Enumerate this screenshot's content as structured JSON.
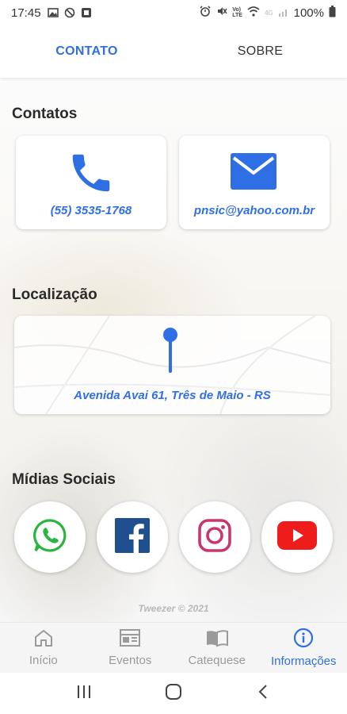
{
  "statusbar": {
    "time": "17:45",
    "battery": "100%",
    "network": "4G",
    "volte": "Vo))\nLTE"
  },
  "tabs": [
    {
      "label": "CONTATO",
      "active": true
    },
    {
      "label": "SOBRE",
      "active": false
    }
  ],
  "contacts": {
    "title": "Contatos",
    "phone": {
      "icon": "phone-icon",
      "label": "(55) 3535-1768"
    },
    "email": {
      "icon": "mail-icon",
      "label": "pnsic@yahoo.com.br"
    }
  },
  "location": {
    "title": "Localização",
    "address": "Avenida Avai 61, Três de Maio - RS",
    "icon": "map-pin-icon"
  },
  "social": {
    "title": "Mídias Sociais",
    "items": [
      {
        "name": "whatsapp",
        "icon": "whatsapp-icon",
        "color": "#2ab540"
      },
      {
        "name": "facebook",
        "icon": "facebook-icon",
        "color": "#1f4f8e"
      },
      {
        "name": "instagram",
        "icon": "instagram-icon",
        "color": "#c7366f"
      },
      {
        "name": "youtube",
        "icon": "youtube-icon",
        "color": "#ee1c1b"
      }
    ]
  },
  "footer": {
    "copyright": "Tweezer © 2021"
  },
  "bottomnav": [
    {
      "label": "Início",
      "icon": "home-icon",
      "active": false
    },
    {
      "label": "Eventos",
      "icon": "calendar-icon",
      "active": false
    },
    {
      "label": "Catequese",
      "icon": "book-icon",
      "active": false
    },
    {
      "label": "Informações",
      "icon": "info-icon",
      "active": true
    }
  ],
  "colors": {
    "accent": "#2f6fe6",
    "inactive": "#9a9a9a"
  }
}
